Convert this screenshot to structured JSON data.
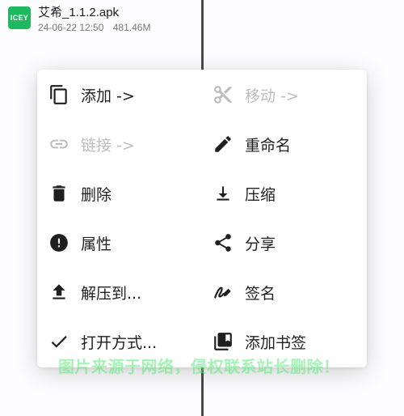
{
  "file": {
    "icon_text": "ICEY",
    "name": "艾希_1.1.2.apk",
    "date": "24-06-22 12:50",
    "size": "481.46M",
    "icon_color": "#1fb861"
  },
  "menu": {
    "left": [
      {
        "label": "添加 ->",
        "icon": "copy-icon",
        "enabled": true
      },
      {
        "label": "链接 ->",
        "icon": "link-icon",
        "enabled": false
      },
      {
        "label": "删除",
        "icon": "trash-icon",
        "enabled": true
      },
      {
        "label": "属性",
        "icon": "info-icon",
        "enabled": true
      },
      {
        "label": "解压到...",
        "icon": "upload-icon",
        "enabled": true
      },
      {
        "label": "打开方式...",
        "icon": "check-icon",
        "enabled": true
      }
    ],
    "right": [
      {
        "label": "移动 ->",
        "icon": "scissors-icon",
        "enabled": false
      },
      {
        "label": "重命名",
        "icon": "pencil-icon",
        "enabled": true
      },
      {
        "label": "压缩",
        "icon": "download-icon",
        "enabled": true
      },
      {
        "label": "分享",
        "icon": "share-icon",
        "enabled": true
      },
      {
        "label": "签名",
        "icon": "signature-icon",
        "enabled": true
      },
      {
        "label": "添加书签",
        "icon": "bookmark-icon",
        "enabled": true
      }
    ]
  },
  "watermark": "图片来源于网络，侵权联系站长删除！",
  "colors": {
    "text": "#1f1f1f",
    "disabled": "#bdbdbd",
    "icon": "#1f1f1f"
  }
}
